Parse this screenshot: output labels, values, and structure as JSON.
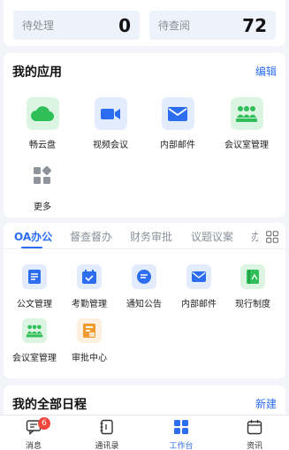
{
  "stats": [
    {
      "label": "待处理",
      "value": "0"
    },
    {
      "label": "待查阅",
      "value": "72"
    }
  ],
  "apps_section": {
    "title": "我的应用",
    "edit_label": "编辑",
    "items": [
      {
        "label": "畅云盘",
        "icon": "cloud-icon"
      },
      {
        "label": "视频会议",
        "icon": "video-camera-icon"
      },
      {
        "label": "内部邮件",
        "icon": "mail-icon"
      },
      {
        "label": "会议室管理",
        "icon": "meeting-room-icon"
      },
      {
        "label": "更多",
        "icon": "more-apps-icon"
      }
    ]
  },
  "oa_section": {
    "tabs": [
      "OA办公",
      "督查督办",
      "财务审批",
      "议题议案",
      "办"
    ],
    "active_tab": "OA办公",
    "items": [
      {
        "label": "公文管理",
        "icon": "document-icon"
      },
      {
        "label": "考勤管理",
        "icon": "calendar-check-icon"
      },
      {
        "label": "通知公告",
        "icon": "chat-bubble-icon"
      },
      {
        "label": "内部邮件",
        "icon": "mail-icon"
      },
      {
        "label": "现行制度",
        "icon": "book-icon"
      },
      {
        "label": "会议室管理",
        "icon": "meeting-room-icon"
      },
      {
        "label": "审批中心",
        "icon": "approval-icon"
      }
    ]
  },
  "schedule_section": {
    "title": "我的全部日程",
    "new_label": "新建"
  },
  "bottom_nav": {
    "items": [
      {
        "label": "消息",
        "icon": "message-icon",
        "badge": "6"
      },
      {
        "label": "通讯录",
        "icon": "contacts-icon"
      },
      {
        "label": "工作台",
        "icon": "workbench-icon"
      },
      {
        "label": "资讯",
        "icon": "news-calendar-icon"
      }
    ],
    "active": "工作台"
  },
  "colors": {
    "accent": "#2c6df2",
    "green": "#2fbf59",
    "badge": "#f0463e",
    "orange": "#f29a2e"
  }
}
